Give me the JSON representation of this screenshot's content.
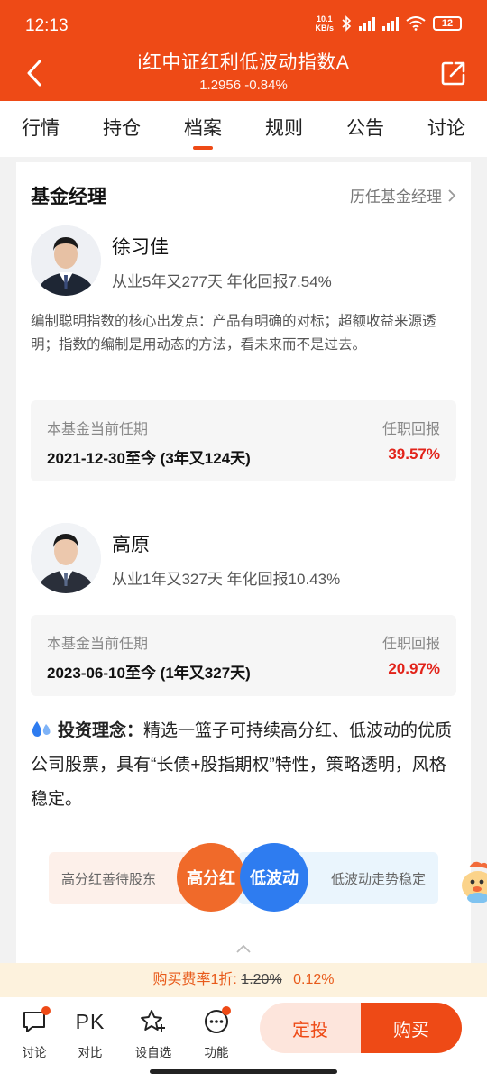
{
  "status_bar": {
    "time": "12:13",
    "net_speed_top": "10.1",
    "net_speed_bottom": "KB/s",
    "battery": "12"
  },
  "header": {
    "title": "i红中证红利低波动指数A",
    "nav_value": "1.2956",
    "change": "-0.84%"
  },
  "tabs": [
    "行情",
    "持仓",
    "档案",
    "规则",
    "公告",
    "讨论"
  ],
  "active_tab": "档案",
  "manager_section": {
    "title": "基金经理",
    "history_link": "历任基金经理"
  },
  "managers": [
    {
      "name": "徐习佳",
      "experience": "从业5年又277天 年化回报7.54%",
      "description": "编制聪明指数的核心出发点：产品有明确的对标；超额收益来源透明；指数的编制是用动态的方法，看未来而不是过去。",
      "tenure_label": "本基金当前任期",
      "tenure_return_label": "任职回报",
      "tenure_period": "2021-12-30至今 (3年又124天)",
      "tenure_return": "39.57%"
    },
    {
      "name": "高原",
      "experience": "从业1年又327天 年化回报10.43%",
      "tenure_label": "本基金当前任期",
      "tenure_return_label": "任职回报",
      "tenure_period": "2023-06-10至今 (1年又327天)",
      "tenure_return": "20.97%"
    }
  ],
  "philosophy": {
    "label": "投资理念：",
    "text": "精选一篮子可持续高分红、低波动的优质公司股票，具有“长债+股指期权”特性，策略透明，风格稳定。"
  },
  "tags": {
    "left_text": "高分红善待股东",
    "left_circle": "高分红",
    "right_circle": "低波动",
    "right_text": "低波动走势稳定"
  },
  "fee_bar": {
    "label": "购买费率1折:",
    "old_rate": "1.20%",
    "new_rate": "0.12%"
  },
  "bottom_bar": {
    "discuss": "讨论",
    "compare_icon": "PK",
    "compare": "对比",
    "watchlist": "设自选",
    "functions": "功能",
    "sip": "定投",
    "buy": "购买"
  },
  "colors": {
    "brand": "#ee4a16",
    "return_red": "#e2231a",
    "tag_orange": "#f06a2a",
    "tag_blue": "#2e7cf0"
  }
}
